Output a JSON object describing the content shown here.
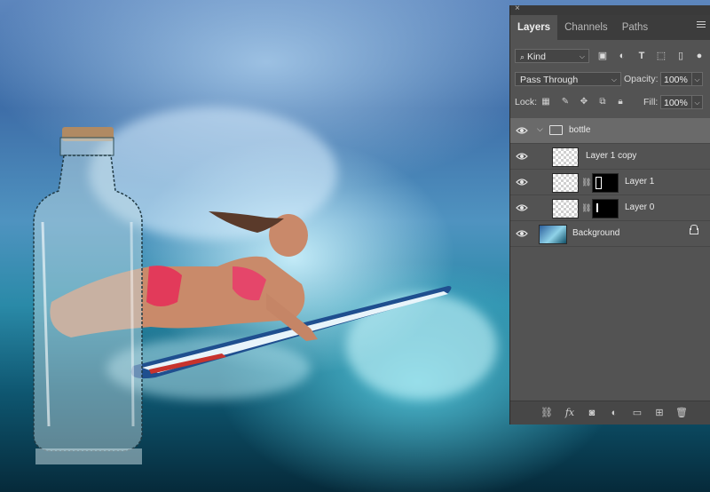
{
  "colors": {
    "panel_bg": "#535353",
    "tab_bar": "#3c3c3c",
    "selected_row": "#6a6a6a"
  },
  "panel": {
    "close_glyph": "×",
    "tabs": [
      {
        "label": "Layers",
        "active": true
      },
      {
        "label": "Channels",
        "active": false
      },
      {
        "label": "Paths",
        "active": false
      }
    ],
    "filter": {
      "kind_label": "Kind",
      "filter_icons": [
        "image-filter-icon",
        "adjustment-filter-icon",
        "type-filter-icon",
        "shape-filter-icon",
        "smart-object-filter-icon",
        "filter-toggle-icon"
      ]
    },
    "blend": {
      "mode": "Pass Through",
      "opacity_label": "Opacity:",
      "opacity": "100%"
    },
    "lock": {
      "label": "Lock:",
      "fill_label": "Fill:",
      "fill": "100%",
      "icons": [
        "lock-transparent-icon",
        "lock-paint-icon",
        "lock-position-icon",
        "lock-artboard-icon",
        "lock-all-icon"
      ]
    },
    "layers": [
      {
        "name": "bottle",
        "kind": "group",
        "expanded": true,
        "selected": true,
        "visible": true
      },
      {
        "name": "Layer 1 copy",
        "kind": "pixel",
        "mask": false,
        "visible": true
      },
      {
        "name": "Layer 1",
        "kind": "pixel",
        "mask": true,
        "visible": true
      },
      {
        "name": "Layer 0",
        "kind": "pixel",
        "mask": true,
        "visible": true
      },
      {
        "name": "Background",
        "kind": "background",
        "locked": true,
        "visible": true
      }
    ],
    "footer_icons": [
      "link-layers-icon",
      "fx-icon",
      "add-mask-icon",
      "adjustment-layer-icon",
      "new-group-icon",
      "new-layer-icon",
      "trash-icon"
    ]
  }
}
